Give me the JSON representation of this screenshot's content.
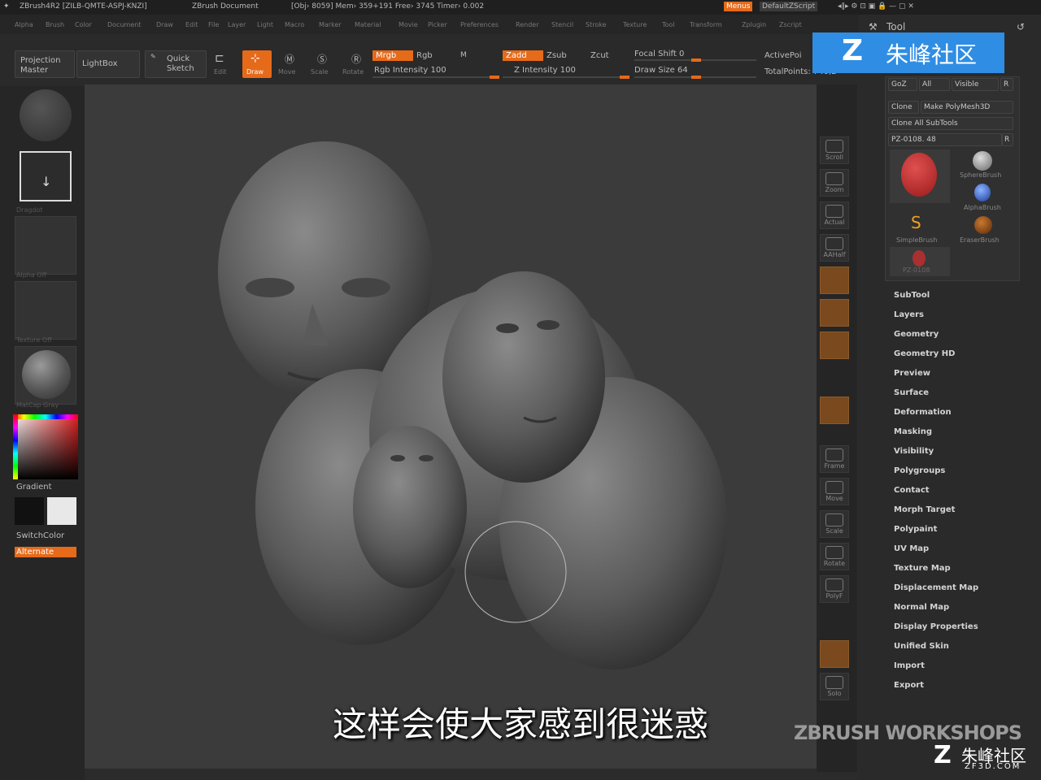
{
  "title_bar": {
    "app": "ZBrush4R2  [ZILB-QMTE-ASPJ-KNZI]",
    "doc": "ZBrush Document",
    "stats": "[Obj› 8059] Mem› 359+191  Free› 3745  Timer› 0.002",
    "menus_btn": "Menus",
    "script": "DefaultZScript"
  },
  "menu_bar": [
    "Alpha",
    "Brush",
    "Color",
    "Document",
    "Draw",
    "Edit",
    "File",
    "Layer",
    "Light",
    "Macro",
    "Marker",
    "Material",
    "Movie",
    "Picker",
    "Preferences",
    "Render",
    "Stencil",
    "Stroke",
    "Texture",
    "Tool",
    "Transform",
    "Zplugin",
    "Zscript"
  ],
  "shelf": {
    "projection_master": "Projection Master",
    "lightbox": "LightBox",
    "quick_sketch": "Quick Sketch",
    "edit": "Edit",
    "draw": "Draw",
    "move": "Move",
    "scale": "Scale",
    "rotate": "Rotate",
    "mrgb": "Mrgb",
    "rgb": "Rgb",
    "m": "M",
    "rgb_intensity": "Rgb Intensity 100",
    "zadd": "Zadd",
    "zsub": "Zsub",
    "zcut": "Zcut",
    "z_intensity": "Z Intensity 100",
    "focal_shift": "Focal Shift 0",
    "draw_size": "Draw Size 64",
    "active_points": "ActivePoi",
    "total_points": "TotalPoints: 740,2"
  },
  "left_panel": {
    "labels": [
      "Gradient",
      "SwitchColor",
      "Alternate"
    ],
    "slots": [
      "Dragdot",
      "Alpha Off",
      "Texture Off",
      "MatCap Gray"
    ]
  },
  "right_shelf": [
    "Scroll",
    "Zoom",
    "Actual",
    "AAHalf",
    "Frame",
    "Move",
    "Scale",
    "Rotate",
    "PolyF",
    "Solo"
  ],
  "tool_panel": {
    "title": "Tool",
    "buttons_row1": [
      "GoZ",
      "All",
      "Visible",
      "R"
    ],
    "clone": "Clone",
    "make_polymesh": "Make PolyMesh3D",
    "clone_all": "Clone All SubTools",
    "current_tool": "PZ-0108. 48",
    "r": "R",
    "brushes": [
      "SphereBrush",
      "AlphaBrush",
      "SimpleBrush",
      "EraserBrush",
      "PZ-0108"
    ],
    "menu_items": [
      "SubTool",
      "Layers",
      "Geometry",
      "Geometry HD",
      "Preview",
      "Surface",
      "Deformation",
      "Masking",
      "Visibility",
      "Polygroups",
      "Contact",
      "Morph Target",
      "Polypaint",
      "UV Map",
      "Texture Map",
      "Displacement Map",
      "Normal Map",
      "Display Properties",
      "Unified Skin",
      "Import",
      "Export"
    ]
  },
  "subtitle": "这样会使大家感到很迷惑",
  "watermarks": {
    "top": "朱峰社区",
    "workshops": "ZBRUSH WORKSHOPS",
    "bottom": "朱峰社区",
    "site": "ZF3D.COM"
  },
  "colors": {
    "accent": "#e56a1a",
    "panel": "#2a2a2a",
    "canvas": "#3b3b3b"
  }
}
